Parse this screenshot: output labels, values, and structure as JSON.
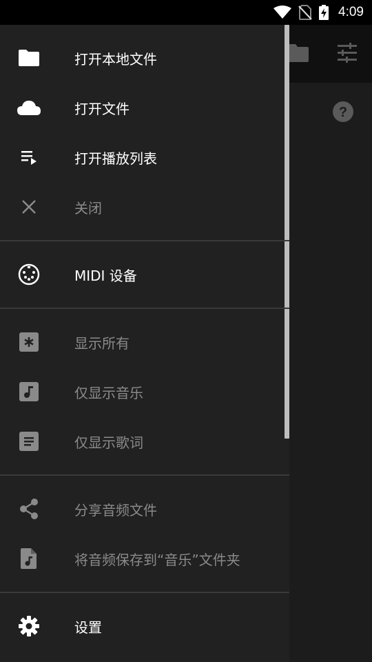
{
  "status_bar": {
    "time": "4:09",
    "icons": [
      "wifi-icon",
      "no-sim-icon",
      "battery-charging-icon"
    ]
  },
  "background_app": {
    "toolbar_icons": [
      "folder-icon",
      "tune-icon"
    ],
    "help_icon": "help-icon"
  },
  "drawer": {
    "items": [
      {
        "label": "打开本地文件",
        "icon": "folder-icon",
        "enabled": true
      },
      {
        "label": "打开文件",
        "icon": "cloud-icon",
        "enabled": true
      },
      {
        "label": "打开播放列表",
        "icon": "playlist-play-icon",
        "enabled": true
      },
      {
        "label": "关闭",
        "icon": "close-icon",
        "enabled": false
      },
      {
        "label": "MIDI 设备",
        "icon": "midi-icon",
        "enabled": true
      },
      {
        "label": "显示所有",
        "icon": "asterisk-icon",
        "enabled": false
      },
      {
        "label": "仅显示音乐",
        "icon": "music-note-icon",
        "enabled": false
      },
      {
        "label": "仅显示歌词",
        "icon": "lyrics-icon",
        "enabled": false
      },
      {
        "label": "分享音频文件",
        "icon": "share-icon",
        "enabled": false
      },
      {
        "label": "将音频保存到“音乐”文件夹",
        "icon": "audio-file-icon",
        "enabled": false
      },
      {
        "label": "设置",
        "icon": "settings-icon",
        "enabled": true
      }
    ]
  },
  "colors": {
    "drawer_bg": "#212121",
    "enabled_text": "#ffffff",
    "disabled_text": "#8a8a8a",
    "divider": "#3a3a3a"
  }
}
